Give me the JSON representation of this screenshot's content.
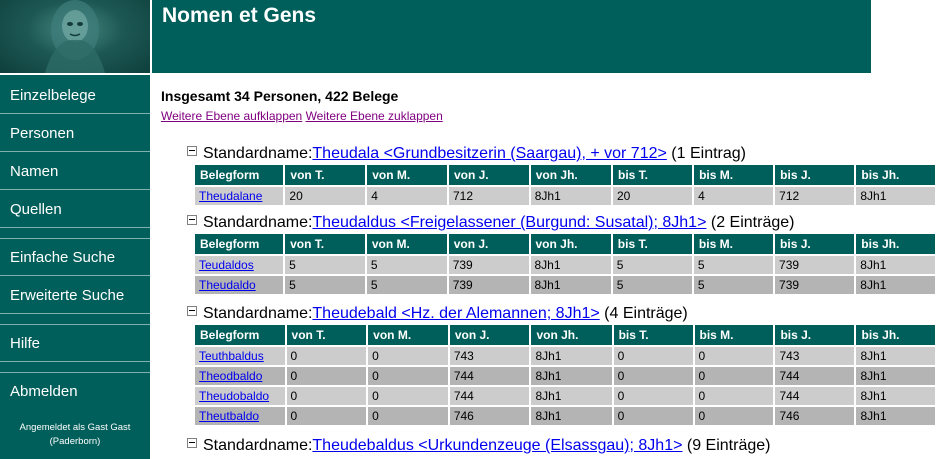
{
  "app": {
    "title": "Nomen et Gens"
  },
  "sidebar": {
    "items": [
      {
        "label": "Einzelbelege"
      },
      {
        "label": "Personen"
      },
      {
        "label": "Namen"
      },
      {
        "label": "Quellen"
      },
      {
        "label": "Einfache Suche"
      },
      {
        "label": "Erweiterte Suche"
      },
      {
        "label": "Hilfe"
      },
      {
        "label": "Abmelden"
      }
    ],
    "login_line1": "Angemeldet als Gast Gast",
    "login_line2": "(Paderborn)"
  },
  "main": {
    "total": "Insgesamt 34 Personen, 422 Belege",
    "expand_label": "Weitere Ebene aufklappen",
    "collapse_label": "Weitere Ebene zuklappen",
    "columns": [
      "Belegform",
      "von T.",
      "von M.",
      "von J.",
      "von Jh.",
      "bis T.",
      "bis M.",
      "bis J.",
      "bis Jh."
    ],
    "groups": [
      {
        "prefix": "Standardname:",
        "name": "Theudala <Grundbesitzerin (Saargau), + vor 712>",
        "count": "(1 Eintrag)",
        "rows": [
          [
            "Theudalane",
            "20",
            "4",
            "712",
            "8Jh1",
            "20",
            "4",
            "712",
            "8Jh1"
          ]
        ]
      },
      {
        "prefix": "Standardname:",
        "name": "Theudaldus <Freigelassener (Burgund: Susatal); 8Jh1>",
        "count": "(2 Einträge)",
        "rows": [
          [
            "Teudaldos",
            "5",
            "5",
            "739",
            "8Jh1",
            "5",
            "5",
            "739",
            "8Jh1"
          ],
          [
            "Theudaldo",
            "5",
            "5",
            "739",
            "8Jh1",
            "5",
            "5",
            "739",
            "8Jh1"
          ]
        ]
      },
      {
        "prefix": "Standardname:",
        "name": "Theudebald <Hz. der Alemannen; 8Jh1>",
        "count": "(4 Einträge)",
        "rows": [
          [
            "Teuthbaldus",
            "0",
            "0",
            "743",
            "8Jh1",
            "0",
            "0",
            "743",
            "8Jh1"
          ],
          [
            "Theodbaldo",
            "0",
            "0",
            "744",
            "8Jh1",
            "0",
            "0",
            "744",
            "8Jh1"
          ],
          [
            "Theudobaldo",
            "0",
            "0",
            "744",
            "8Jh1",
            "0",
            "0",
            "744",
            "8Jh1"
          ],
          [
            "Theutbaldo",
            "0",
            "0",
            "746",
            "8Jh1",
            "0",
            "0",
            "746",
            "8Jh1"
          ]
        ]
      },
      {
        "prefix": "Standardname:",
        "name": "Theudebaldus <Urkundenzeuge (Elsassgau); 8Jh1>",
        "count": "(9 Einträge)",
        "rows": []
      }
    ]
  }
}
